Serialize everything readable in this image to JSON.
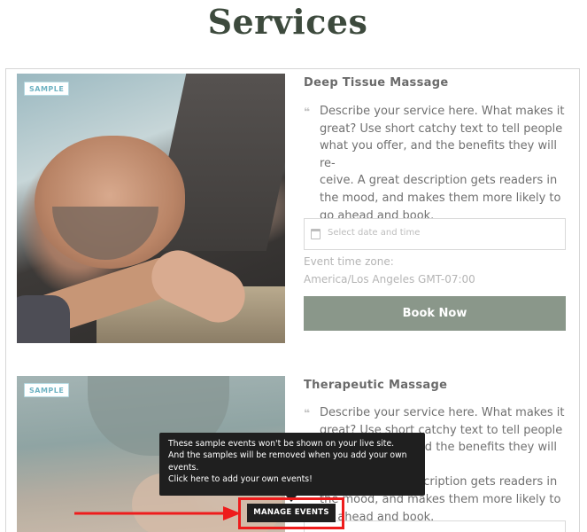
{
  "page": {
    "title": "Services"
  },
  "services": [
    {
      "badge": "SAMPLE",
      "name": "Deep Tissue Massage",
      "description": "Describe your service here. What makes it great? Use short catchy text to tell people what you offer, and the benefits they will re-ceive. A great description gets readers in the mood, and makes them more likely to go ahead and book.",
      "date_placeholder": "Select date and time",
      "timezone_label": "Event time zone:",
      "timezone_value": "America/Los Angeles GMT-07:00",
      "book_label": "Book Now"
    },
    {
      "badge": "SAMPLE",
      "name": "Therapeutic Massage",
      "description": "Describe your service here. What makes it great? Use short catchy text to tell people what you offer, and the benefits they will re-ceive. A great description gets readers in the mood, and makes them more likely to go ahead and book."
    }
  ],
  "tooltip": {
    "text": "These sample events won't be shown on your live site. And the samples will be removed when you add your own events. Click here to add your own events!",
    "line1": "These sample events won't be shown on your live site.",
    "line2": "And the samples will be removed when you add your own",
    "line3": "events.",
    "line4": "Click here to add your own events!",
    "button_label": "MANAGE EVENTS"
  },
  "colors": {
    "title": "#3d4a3d",
    "button": "#8a978a",
    "badge_border": "#b7dbe3",
    "highlight": "#ee1c1c",
    "tooltip_bg": "#1f1f1f"
  }
}
